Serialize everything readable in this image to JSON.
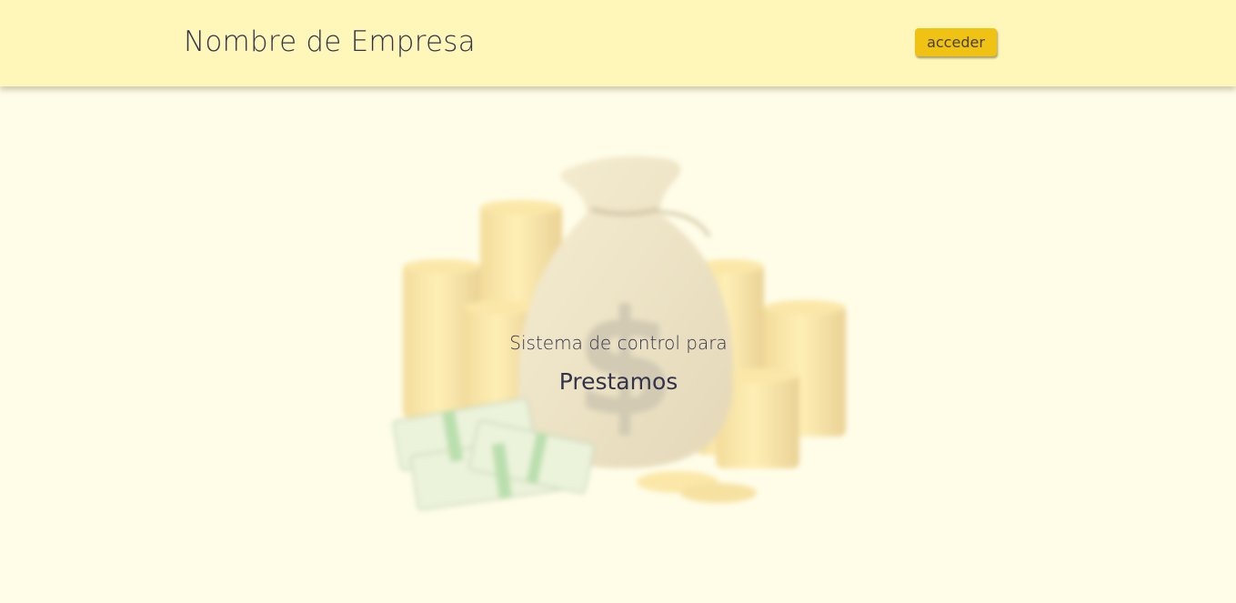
{
  "header": {
    "brand": "Nombre de Empresa",
    "login_label": "acceder"
  },
  "hero": {
    "subtitle": "Sistema de control para",
    "title": "Prestamos"
  },
  "colors": {
    "header_bg": "#fff6ba",
    "page_bg": "#fffde8",
    "button_bg": "#f0c214",
    "text": "#33334a"
  }
}
